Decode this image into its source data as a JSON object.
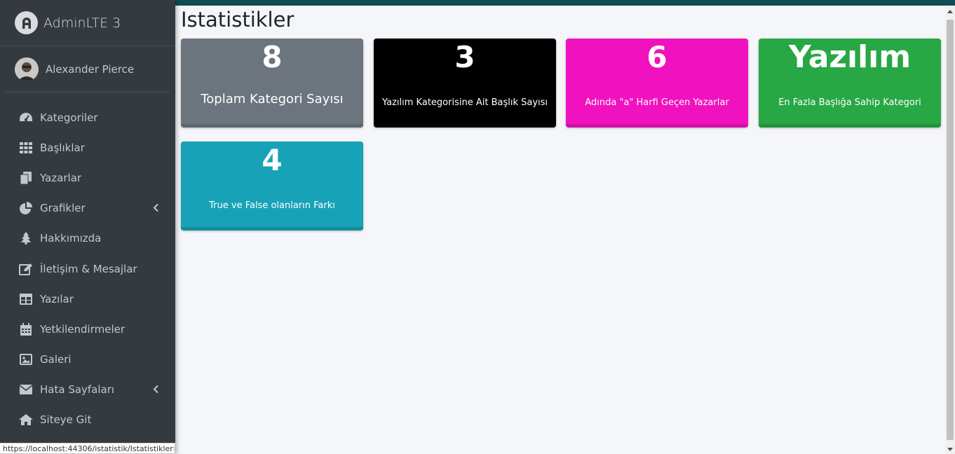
{
  "brand": {
    "name": "AdminLTE 3"
  },
  "user": {
    "name": "Alexander Pierce"
  },
  "sidebar": {
    "items": [
      {
        "label": "Kategoriler",
        "icon": "tachometer-icon",
        "has_chevron": false
      },
      {
        "label": "Başlıklar",
        "icon": "grid-icon",
        "has_chevron": false
      },
      {
        "label": "Yazarlar",
        "icon": "copy-icon",
        "has_chevron": false
      },
      {
        "label": "Grafikler",
        "icon": "pie-chart-icon",
        "has_chevron": true
      },
      {
        "label": "Hakkımızda",
        "icon": "tree-icon",
        "has_chevron": false
      },
      {
        "label": "İletişim & Mesajlar",
        "icon": "edit-icon",
        "has_chevron": false
      },
      {
        "label": "Yazılar",
        "icon": "table-icon",
        "has_chevron": false
      },
      {
        "label": "Yetkilendirmeler",
        "icon": "calendar-icon",
        "has_chevron": false
      },
      {
        "label": "Galeri",
        "icon": "image-icon",
        "has_chevron": false
      },
      {
        "label": "Hata Sayfaları",
        "icon": "envelope-icon",
        "has_chevron": true
      },
      {
        "label": "Siteye Git",
        "icon": "home-icon",
        "has_chevron": false
      }
    ]
  },
  "page": {
    "title": "Istatistikler"
  },
  "cards": [
    {
      "value": "8",
      "label": "Toplam Kategori Sayısı",
      "color": "#6c757d"
    },
    {
      "value": "3",
      "label": "Yazılım Kategorisine Ait Başlık Sayısı",
      "color": "#000000"
    },
    {
      "value": "6",
      "label": "Adında \"a\" Harfi Geçen Yazarlar",
      "color": "#f012be"
    },
    {
      "value": "Yazılım",
      "label": "En Fazla Başlığa Sahip Kategori",
      "color": "#28a745"
    },
    {
      "value": "4",
      "label": "True ve False olanların Farkı",
      "color": "#17a2b8"
    }
  ],
  "statusbar": {
    "url": "https://localhost:44306/istatistik/Istatistikler#"
  }
}
